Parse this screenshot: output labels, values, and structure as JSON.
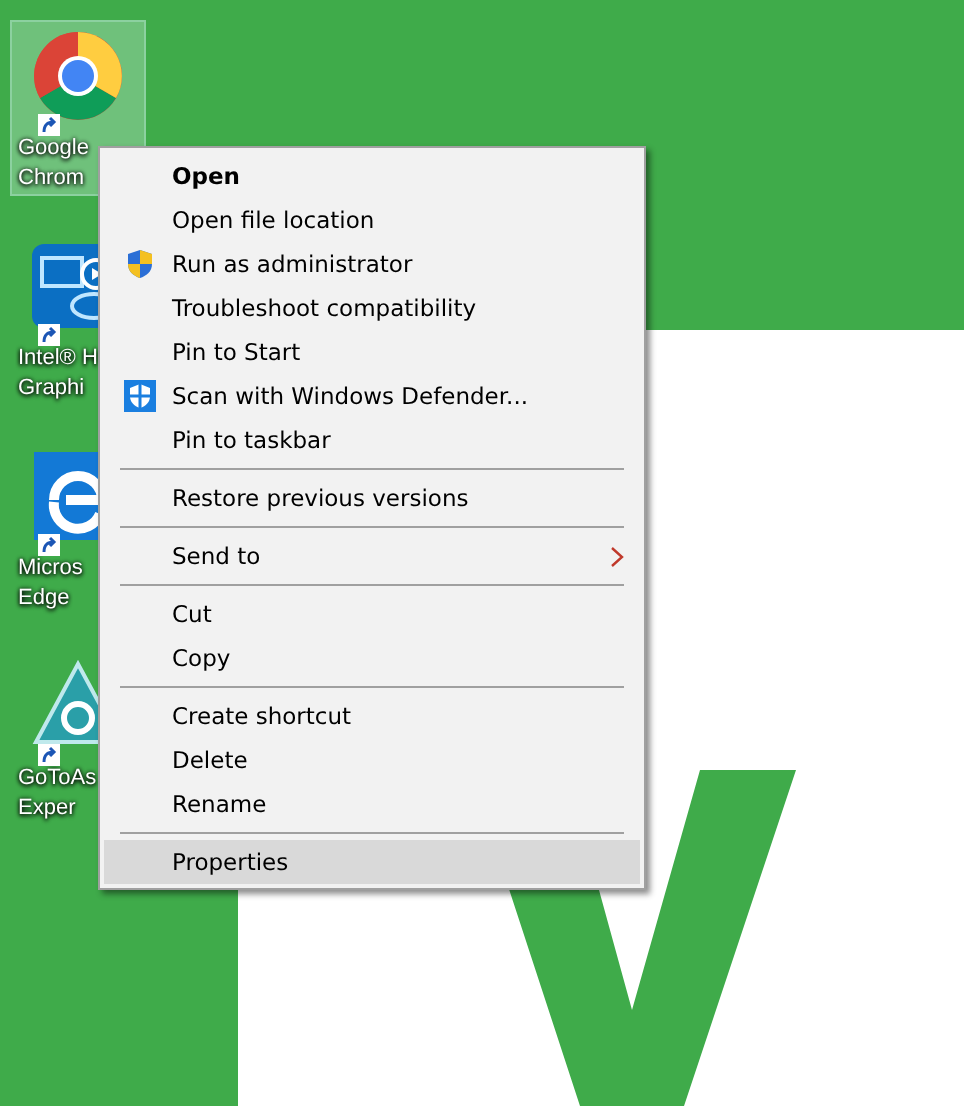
{
  "desktop_icons": [
    {
      "label": "Google Chrom",
      "selected": true
    },
    {
      "label": "Intel® H Graphi",
      "selected": false
    },
    {
      "label": "Micros Edge",
      "selected": false
    },
    {
      "label": "GoToAs Exper",
      "selected": false
    }
  ],
  "context_menu": {
    "items": [
      {
        "kind": "item",
        "label": "Open",
        "bold": true,
        "selected": false
      },
      {
        "kind": "item",
        "label": "Open file location",
        "selected": false
      },
      {
        "kind": "item",
        "label": "Run as administrator",
        "selected": false
      },
      {
        "kind": "item",
        "label": "Troubleshoot compatibility",
        "selected": false
      },
      {
        "kind": "item",
        "label": "Pin to Start",
        "selected": false
      },
      {
        "kind": "item",
        "label": "Scan with Windows Defender...",
        "selected": false
      },
      {
        "kind": "item",
        "label": "Pin to taskbar",
        "selected": false
      },
      {
        "kind": "separator"
      },
      {
        "kind": "item",
        "label": "Restore previous versions",
        "selected": false
      },
      {
        "kind": "separator"
      },
      {
        "kind": "item",
        "label": "Send to",
        "submenu": true,
        "selected": false
      },
      {
        "kind": "separator"
      },
      {
        "kind": "item",
        "label": "Cut",
        "selected": false
      },
      {
        "kind": "item",
        "label": "Copy",
        "selected": false
      },
      {
        "kind": "separator"
      },
      {
        "kind": "item",
        "label": "Create shortcut",
        "selected": false
      },
      {
        "kind": "item",
        "label": "Delete",
        "selected": false
      },
      {
        "kind": "item",
        "label": "Rename",
        "selected": false
      },
      {
        "kind": "separator"
      },
      {
        "kind": "item",
        "label": "Properties",
        "selected": true
      }
    ]
  }
}
